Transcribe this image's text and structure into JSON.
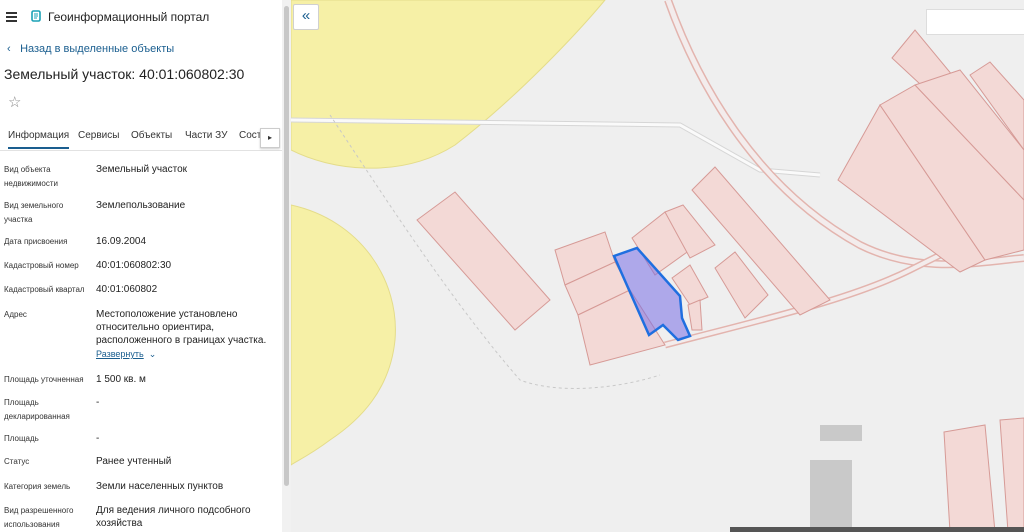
{
  "app": {
    "title": "Геоинформационный портал"
  },
  "nav": {
    "back_label": "Назад в выделенные объекты"
  },
  "object": {
    "title": "Земельный участок: 40:01:060802:30"
  },
  "tabs": [
    {
      "label": "Информация",
      "active": true
    },
    {
      "label": "Сервисы"
    },
    {
      "label": "Объекты"
    },
    {
      "label": "Части ЗУ"
    },
    {
      "label": "Соста"
    }
  ],
  "fields": [
    {
      "label": "Вид объекта недвижимости",
      "value": "Земельный участок"
    },
    {
      "label": "Вид земельного участка",
      "value": "Землепользование"
    },
    {
      "label": "Дата присвоения",
      "value": "16.09.2004"
    },
    {
      "label": "Кадастровый номер",
      "value": "40:01:060802:30"
    },
    {
      "label": "Кадастровый квартал",
      "value": "40:01:060802"
    },
    {
      "label": "Адрес",
      "value": "Местоположение установлено относительно ориентира, расположенного в границах участка."
    },
    {
      "label": "Площадь уточненная",
      "value": "1 500 кв. м"
    },
    {
      "label": "Площадь декларированная",
      "value": "-"
    },
    {
      "label": "Площадь",
      "value": "-"
    },
    {
      "label": "Статус",
      "value": "Ранее учтенный"
    },
    {
      "label": "Категория земель",
      "value": "Земли населенных пунктов"
    },
    {
      "label": "Вид разрешенного использования",
      "value": "Для ведения личного подсобного хозяйства"
    }
  ],
  "address_expand_label": "Развернуть",
  "colors": {
    "accent": "#1a5e8f",
    "parcel_fill": "#f3d9d6",
    "parcel_stroke": "#d69a96",
    "selected": "#1f6fe0",
    "zone": "#f6f0a6"
  }
}
